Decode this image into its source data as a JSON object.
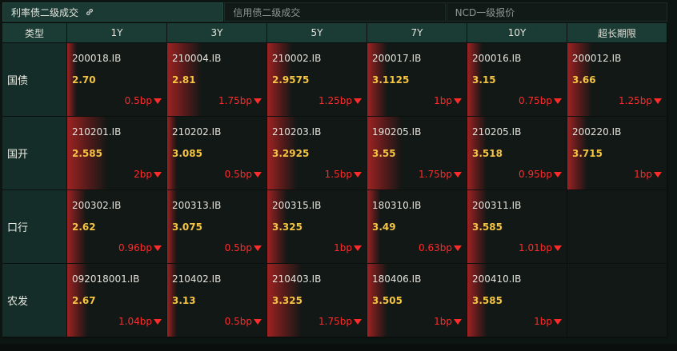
{
  "tabs": [
    {
      "label": "利率债二级成交",
      "active": true
    },
    {
      "label": "信用债二级成交",
      "active": false
    },
    {
      "label": "NCD一级报价",
      "active": false
    }
  ],
  "header": [
    "类型",
    "1Y",
    "3Y",
    "5Y",
    "7Y",
    "10Y",
    "超长期限"
  ],
  "rows": [
    {
      "label": "国债",
      "cells": [
        {
          "code": "200018.IB",
          "yield": "2.70",
          "change": "0.5bp",
          "bar_fraction": 0.1
        },
        {
          "code": "210004.IB",
          "yield": "2.81",
          "change": "1.75bp",
          "bar_fraction": 0.35
        },
        {
          "code": "210002.IB",
          "yield": "2.9575",
          "change": "1.25bp",
          "bar_fraction": 0.25
        },
        {
          "code": "200017.IB",
          "yield": "3.1125",
          "change": "1bp",
          "bar_fraction": 0.2
        },
        {
          "code": "200016.IB",
          "yield": "3.15",
          "change": "0.75bp",
          "bar_fraction": 0.15
        },
        {
          "code": "200012.IB",
          "yield": "3.66",
          "change": "1.25bp",
          "bar_fraction": 0.25
        }
      ]
    },
    {
      "label": "国开",
      "cells": [
        {
          "code": "210201.IB",
          "yield": "2.585",
          "change": "2bp",
          "bar_fraction": 0.4
        },
        {
          "code": "210202.IB",
          "yield": "3.085",
          "change": "0.5bp",
          "bar_fraction": 0.1
        },
        {
          "code": "210203.IB",
          "yield": "3.2925",
          "change": "1.5bp",
          "bar_fraction": 0.3
        },
        {
          "code": "190205.IB",
          "yield": "3.55",
          "change": "1.75bp",
          "bar_fraction": 0.35
        },
        {
          "code": "210205.IB",
          "yield": "3.518",
          "change": "0.95bp",
          "bar_fraction": 0.19
        },
        {
          "code": "200220.IB",
          "yield": "3.715",
          "change": "1bp",
          "bar_fraction": 0.2
        }
      ]
    },
    {
      "label": "口行",
      "cells": [
        {
          "code": "200302.IB",
          "yield": "2.62",
          "change": "0.96bp",
          "bar_fraction": 0.19
        },
        {
          "code": "200313.IB",
          "yield": "3.075",
          "change": "0.5bp",
          "bar_fraction": 0.1
        },
        {
          "code": "200315.IB",
          "yield": "3.325",
          "change": "1bp",
          "bar_fraction": 0.2
        },
        {
          "code": "180310.IB",
          "yield": "3.49",
          "change": "0.63bp",
          "bar_fraction": 0.13
        },
        {
          "code": "200311.IB",
          "yield": "3.585",
          "change": "1.01bp",
          "bar_fraction": 0.2
        },
        null
      ]
    },
    {
      "label": "农发",
      "cells": [
        {
          "code": "092018001.IB",
          "yield": "2.67",
          "change": "1.04bp",
          "bar_fraction": 0.21
        },
        {
          "code": "210402.IB",
          "yield": "3.13",
          "change": "0.5bp",
          "bar_fraction": 0.1
        },
        {
          "code": "210403.IB",
          "yield": "3.325",
          "change": "1.75bp",
          "bar_fraction": 0.35
        },
        {
          "code": "180406.IB",
          "yield": "3.505",
          "change": "1bp",
          "bar_fraction": 0.2
        },
        {
          "code": "200410.IB",
          "yield": "3.585",
          "change": "1bp",
          "bar_fraction": 0.2
        },
        null
      ]
    }
  ],
  "colors": {
    "accent": "#1b3a33",
    "yield": "#f5c443",
    "down": "#ff2a2a",
    "bar": "#a52323"
  }
}
